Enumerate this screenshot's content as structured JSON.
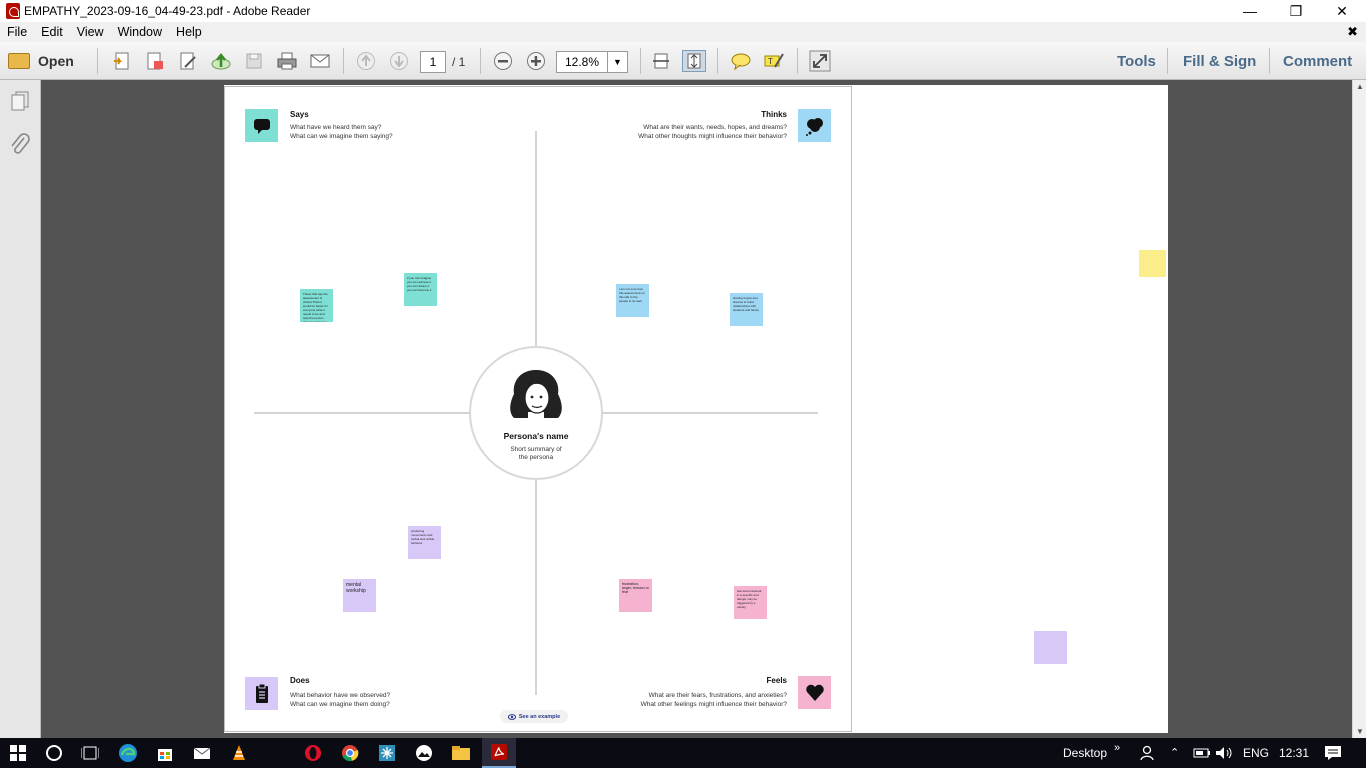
{
  "window": {
    "title": "EMPATHY_2023-09-16_04-49-23.pdf - Adobe Reader"
  },
  "menu": {
    "items": [
      "File",
      "Edit",
      "View",
      "Window",
      "Help"
    ]
  },
  "toolbar": {
    "open_label": "Open",
    "page_current": "1",
    "page_total": "/ 1",
    "zoom": "12.8%",
    "tools_label": "Tools",
    "fill_sign_label": "Fill & Sign",
    "comment_label": "Comment"
  },
  "map": {
    "says": {
      "title": "Says",
      "line1": "What have we heard them say?",
      "line2": "What can we imagine them saying?"
    },
    "thinks": {
      "title": "Thinks",
      "line1": "What are their wants, needs, hopes, and dreams?",
      "line2": "What other thoughts might influence their behavior?"
    },
    "does": {
      "title": "Does",
      "line1": "What behavior have we observed?",
      "line2": "What can we imagine them doing?"
    },
    "feels": {
      "title": "Feels",
      "line1": "What are their fears, frustrations, and anxieties?",
      "line2": "What other feelings might influence their behavior?"
    },
    "persona_name": "Persona's name",
    "persona_summary_1": "Short summary of",
    "persona_summary_2": "the persona",
    "see_example": "See an example",
    "notes": {
      "says1": "Those that say the assessment is critical Think it would be better for everyone what it needs to be and help the person when it matters to the family",
      "says2": "if you can imagine you can achieve it you can dream it you can become it",
      "thinks1": "I am not sure how this assessment on this talk to the people to do well",
      "thinks2": "sharing hopes and dreams to build relationships with students and family",
      "does1": "producing movements and verbal and verbal behavior",
      "does2": "mental workship",
      "feels1": "frustration, anger, tension or fear",
      "feels2": "feel sad emotional in a specific and danger may be triggered by a variety"
    }
  },
  "taskbar": {
    "desktop_label": "Desktop",
    "lang": "ENG",
    "time": "12:31"
  },
  "colors": {
    "teal": "#7ee0d4",
    "blue": "#9fd8f5",
    "lavender": "#d7c8f7",
    "pink": "#f6b3d0",
    "yellow": "#fbee8a"
  }
}
